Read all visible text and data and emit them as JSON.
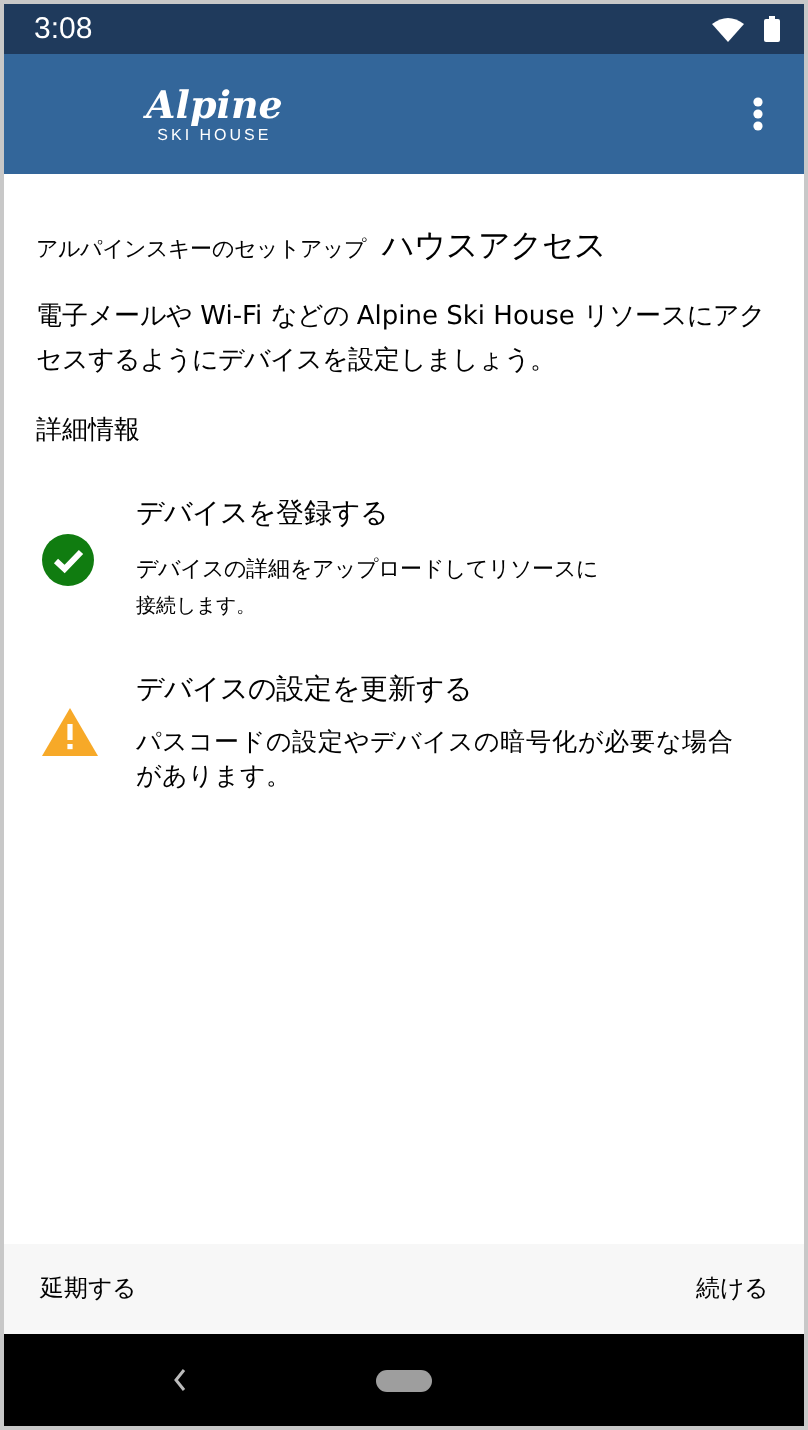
{
  "status_bar": {
    "time": "3:08"
  },
  "app_bar": {
    "logo_title": "Alpine",
    "logo_subtitle": "SKI HOUSE"
  },
  "heading": {
    "prefix": "アルパインスキーのセットアップ",
    "title": "ハウスアクセス"
  },
  "description": "電子メールや Wi-Fi などの Alpine Ski House リソースにアクセスするようにデバイスを設定しましょう。",
  "more_info_link": "詳細情報",
  "steps": [
    {
      "kind": "done",
      "title": "デバイスを登録する",
      "detail": "デバイスの詳細をアップロードしてリソースに",
      "detail_continued": "接続します。"
    },
    {
      "kind": "warning",
      "title": "デバイスの設定を更新する",
      "detail": "パスコードの設定やデバイスの暗号化が必要な場合",
      "detail_continued": "があります。"
    }
  ],
  "footer": {
    "postpone": "延期する",
    "continue": "続ける"
  }
}
